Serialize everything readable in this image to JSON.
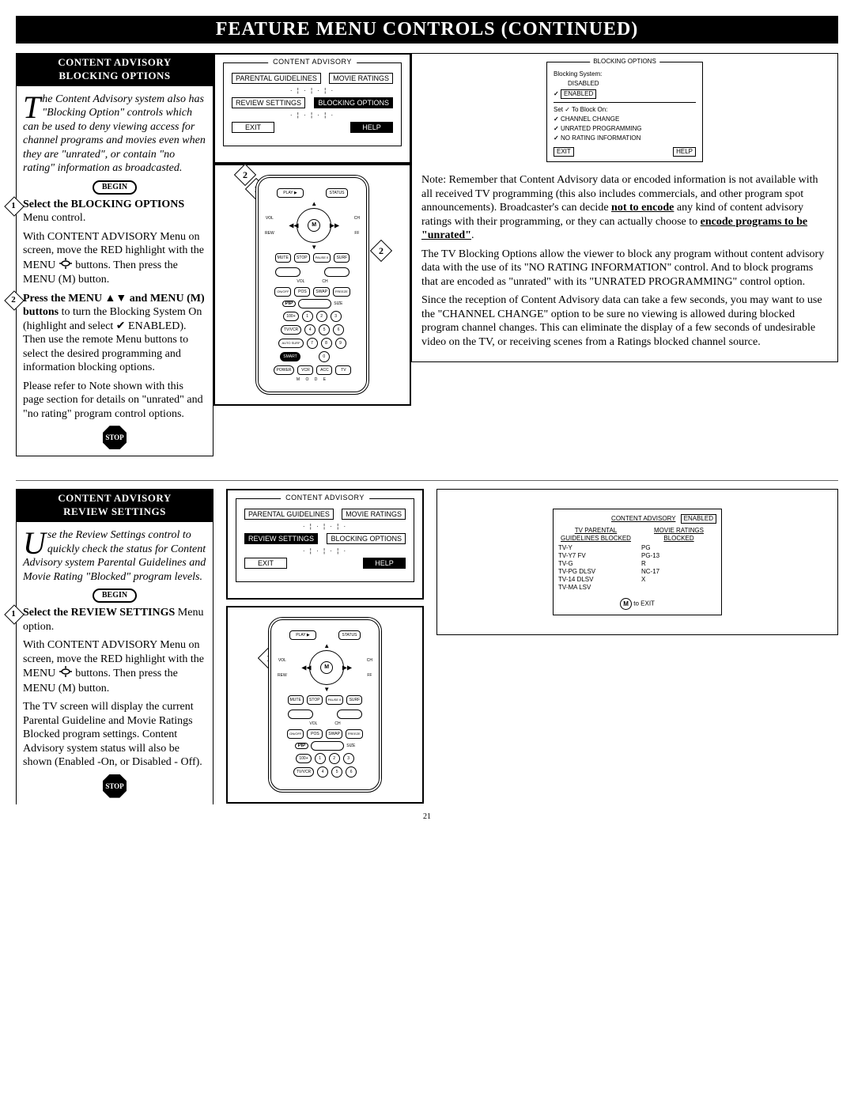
{
  "page_title": "FEATURE MENU CONTROLS (CONTINUED)",
  "page_number": "21",
  "section1": {
    "tab_line1": "CONTENT ADVISORY",
    "tab_line2": "BLOCKING OPTIONS",
    "dropcap": "T",
    "intro_rest": "he Content Advisory system also has \"Blocking Option\" controls which can be used to deny viewing access for channel programs and movies even when they are \"unrated\", or contain \"no rating\" information as broadcasted.",
    "begin": "BEGIN",
    "step1_num": "1",
    "step1_bold": "Select the BLOCKING OPTIONS",
    "step1_rest": " Menu control.",
    "step1_p1a": "With CONTENT ADVISORY Menu on screen, move the RED highlight with the MENU ",
    "step1_p1b": " buttons. Then press the MENU (M) button.",
    "step2_num": "2",
    "step2_bold": "Press the MENU ▲▼ and MENU (M) buttons",
    "step2_rest": " to turn the Blocking System On (highlight and select ✔ ENABLED). Then use the remote Menu buttons to select the desired programming and information blocking options.",
    "step2_p2": "Please refer to Note shown with this page section for details on \"unrated\" and \"no rating\" program control options.",
    "stop": "STOP",
    "osd": {
      "title": "CONTENT ADVISORY",
      "btns": [
        "PARENTAL GUIDELINES",
        "MOVIE RATINGS",
        "REVIEW SETTINGS",
        "BLOCKING OPTIONS",
        "EXIT",
        "HELP"
      ]
    },
    "blocking_osd": {
      "title": "BLOCKING OPTIONS",
      "sub1": "Blocking System:",
      "opt_disabled": "DISABLED",
      "opt_enabled": "ENABLED",
      "sub2": "Set ✓ To Block On:",
      "c1": "CHANNEL CHANGE",
      "c2": "UNRATED PROGRAMMING",
      "c3": "NO RATING INFORMATION",
      "exit": "EXIT",
      "help": "HELP"
    },
    "note": {
      "p1a": "Note: Remember that Content Advisory data or encoded information is not available with all received TV programming (this also includes commercials, and other program spot announcements). Broadcaster's can decide ",
      "p1b": "not to encode",
      "p1c": " any kind of content advisory ratings with their programming, or they can actually choose to ",
      "p1d": "encode programs to be \"unrated\"",
      "p1e": ".",
      "p2": "The TV Blocking Options allow the viewer to block any program without content advisory data with the use of its \"NO RATING INFORMATION\" control. And to block programs that are encoded as \"unrated\" with its \"UNRATED PROGRAMMING\" control option.",
      "p3": "Since the reception of Content Advisory data can take a few seconds, you may want to use the \"CHANNEL CHANGE\" option to be sure no viewing is allowed during blocked program channel changes. This can eliminate the display of a few seconds of undesirable video on the TV, or receiving scenes from a Ratings blocked channel source."
    }
  },
  "section2": {
    "tab_line1": "CONTENT ADVISORY",
    "tab_line2": "REVIEW SETTINGS",
    "dropcap": "U",
    "intro_rest": "se the Review Settings control to quickly check the status for Content Advisory system Parental Guidelines and Movie Rating \"Blocked\" program levels.",
    "begin": "BEGIN",
    "step1_num": "1",
    "step1_bold": "Select the REVIEW SETTINGS",
    "step1_rest": " Menu option.",
    "step1_p1a": "With CONTENT ADVISORY Menu on screen, move the RED highlight with the MENU ",
    "step1_p1b": " buttons. Then press the MENU (M) button.",
    "step1_p2": "The TV screen will display the current Parental Guideline and Movie Ratings Blocked program settings. Content Advisory system status will also be shown (Enabled -On, or Disabled - Off).",
    "stop": "STOP",
    "osd": {
      "title": "CONTENT ADVISORY",
      "btns": [
        "PARENTAL GUIDELINES",
        "MOVIE RATINGS",
        "REVIEW SETTINGS",
        "BLOCKING OPTIONS",
        "EXIT",
        "HELP"
      ]
    },
    "review": {
      "title": "CONTENT ADVISORY",
      "status": "ENABLED",
      "col1_head": "TV PARENTAL GUIDELINES BLOCKED",
      "col1": [
        "TV-Y",
        "TV-Y7  FV",
        "TV-G",
        "TV-PG DLSV",
        "TV-14  DLSV",
        "TV-MA  LSV"
      ],
      "col2_head": "MOVIE RATINGS BLOCKED",
      "col2": [
        "PG",
        "PG-13",
        "R",
        "NC-17",
        "X"
      ],
      "footer": " to EXIT"
    }
  },
  "remote": {
    "top_row": [
      "PLAY ▶",
      "STATUS"
    ],
    "side_l": [
      "VOL",
      "REW"
    ],
    "side_r": [
      "CH",
      "FF"
    ],
    "bottom_row": [
      "MUTE",
      "STOP",
      "PAUSE II",
      "SURF"
    ],
    "row_pip_top": [
      "ON/OFF",
      "POS",
      "SWAP",
      "FREEZE"
    ],
    "pip": "PIP",
    "size": "SIZE",
    "row_a": [
      "100+",
      "1",
      "2",
      "3"
    ],
    "row_b": [
      "TV/VCR",
      "4",
      "5",
      "6"
    ],
    "row_c": [
      "AUTO SURF",
      "7",
      "8",
      "9"
    ],
    "row_d_label": "SMART",
    "row_d": [
      "",
      "0",
      ""
    ],
    "row_e": [
      "POWER",
      "VCR",
      "ACC",
      "TV"
    ],
    "mode": "M    O    D    E",
    "m": "M"
  }
}
